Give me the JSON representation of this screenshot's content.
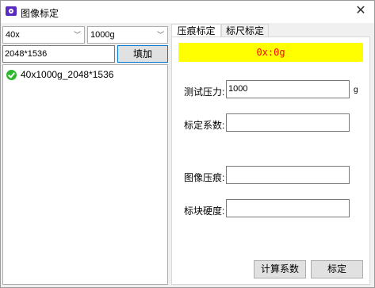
{
  "window": {
    "title": "图像标定",
    "close_glyph": "✕"
  },
  "left": {
    "lens_select": {
      "value": "40x"
    },
    "load_select": {
      "value": "1000g"
    },
    "resolution_input": {
      "value": "2048*1536"
    },
    "add_button": "填加",
    "list": [
      {
        "label": "40x1000g_2048*1536",
        "status": "ok"
      }
    ]
  },
  "tabs": [
    {
      "label": "压痕标定",
      "active": true
    },
    {
      "label": "标尺标定",
      "active": false
    }
  ],
  "panel": {
    "status_text": "0x:0g",
    "status_colors": {
      "background": "#ffff00",
      "text": "#ff0000"
    },
    "fields": {
      "test_force": {
        "label": "测试压力:",
        "value": "1000",
        "unit": "g"
      },
      "coefficient": {
        "label": "标定系数:",
        "value": ""
      },
      "image_indent": {
        "label": "图像压痕:",
        "value": ""
      },
      "block_hardness": {
        "label": "标块硬度:",
        "value": ""
      }
    },
    "calc_button": "计算系数",
    "calibrate_button": "标定"
  },
  "icons": {
    "app": "camera-icon",
    "chevron": "chevron-down-icon",
    "list_status": "check-circle-icon"
  }
}
